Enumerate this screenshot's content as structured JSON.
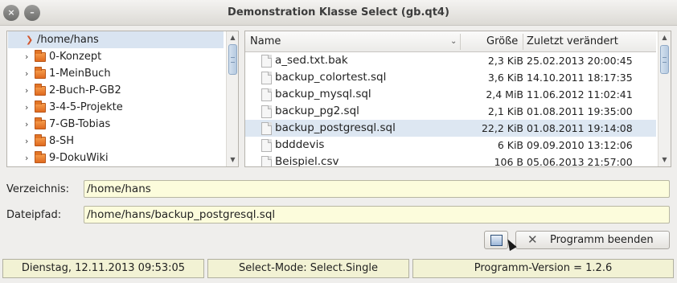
{
  "window": {
    "title": "Demonstration Klasse Select (gb.qt4)",
    "close_glyph": "×",
    "minimize_glyph": "–"
  },
  "tree": {
    "root": "/home/hans",
    "items": [
      "0-Konzept",
      "1-MeinBuch",
      "2-Buch-P-GB2",
      "3-4-5-Projekte",
      "7-GB-Tobias",
      "8-SH",
      "9-DokuWiki"
    ]
  },
  "files": {
    "headers": {
      "name": "Name",
      "size": "Größe",
      "modified": "Zuletzt verändert"
    },
    "rows": [
      {
        "name": "a_sed.txt.bak",
        "size": "2,3 KiB",
        "modified": "25.02.2013 20:00:45"
      },
      {
        "name": "backup_colortest.sql",
        "size": "3,6 KiB",
        "modified": "14.10.2011 18:17:35"
      },
      {
        "name": "backup_mysql.sql",
        "size": "2,4 MiB",
        "modified": "11.06.2012 11:02:41"
      },
      {
        "name": "backup_pg2.sql",
        "size": "2,1 KiB",
        "modified": "01.08.2011 19:35:00"
      },
      {
        "name": "backup_postgresql.sql",
        "size": "22,2 KiB",
        "modified": "01.08.2011 19:14:08"
      },
      {
        "name": "bdddevis",
        "size": "6 KiB",
        "modified": "09.09.2010 13:12:06"
      },
      {
        "name": "Beispiel.csv",
        "size": "106 B",
        "modified": "05.06.2013 21:57:00"
      }
    ],
    "selected_index": 4
  },
  "form": {
    "dir_label": "Verzeichnis:",
    "dir_value": "/home/hans",
    "path_label": "Dateipfad:",
    "path_value": "/home/hans/backup_postgresql.sql"
  },
  "buttons": {
    "quit_glyph": "✕",
    "quit_label": "Programm beenden"
  },
  "status": {
    "datetime": "Dienstag, 12.11.2013 09:53:05",
    "mode": "Select-Mode:  Select.Single",
    "version": "Programm-Version = 1.2.6"
  },
  "icons": {
    "tree_expand": "chevron-right-icon",
    "folder": "folder-icon",
    "file": "file-icon",
    "sort": "chevron-down-icon",
    "quit": "close-icon"
  }
}
